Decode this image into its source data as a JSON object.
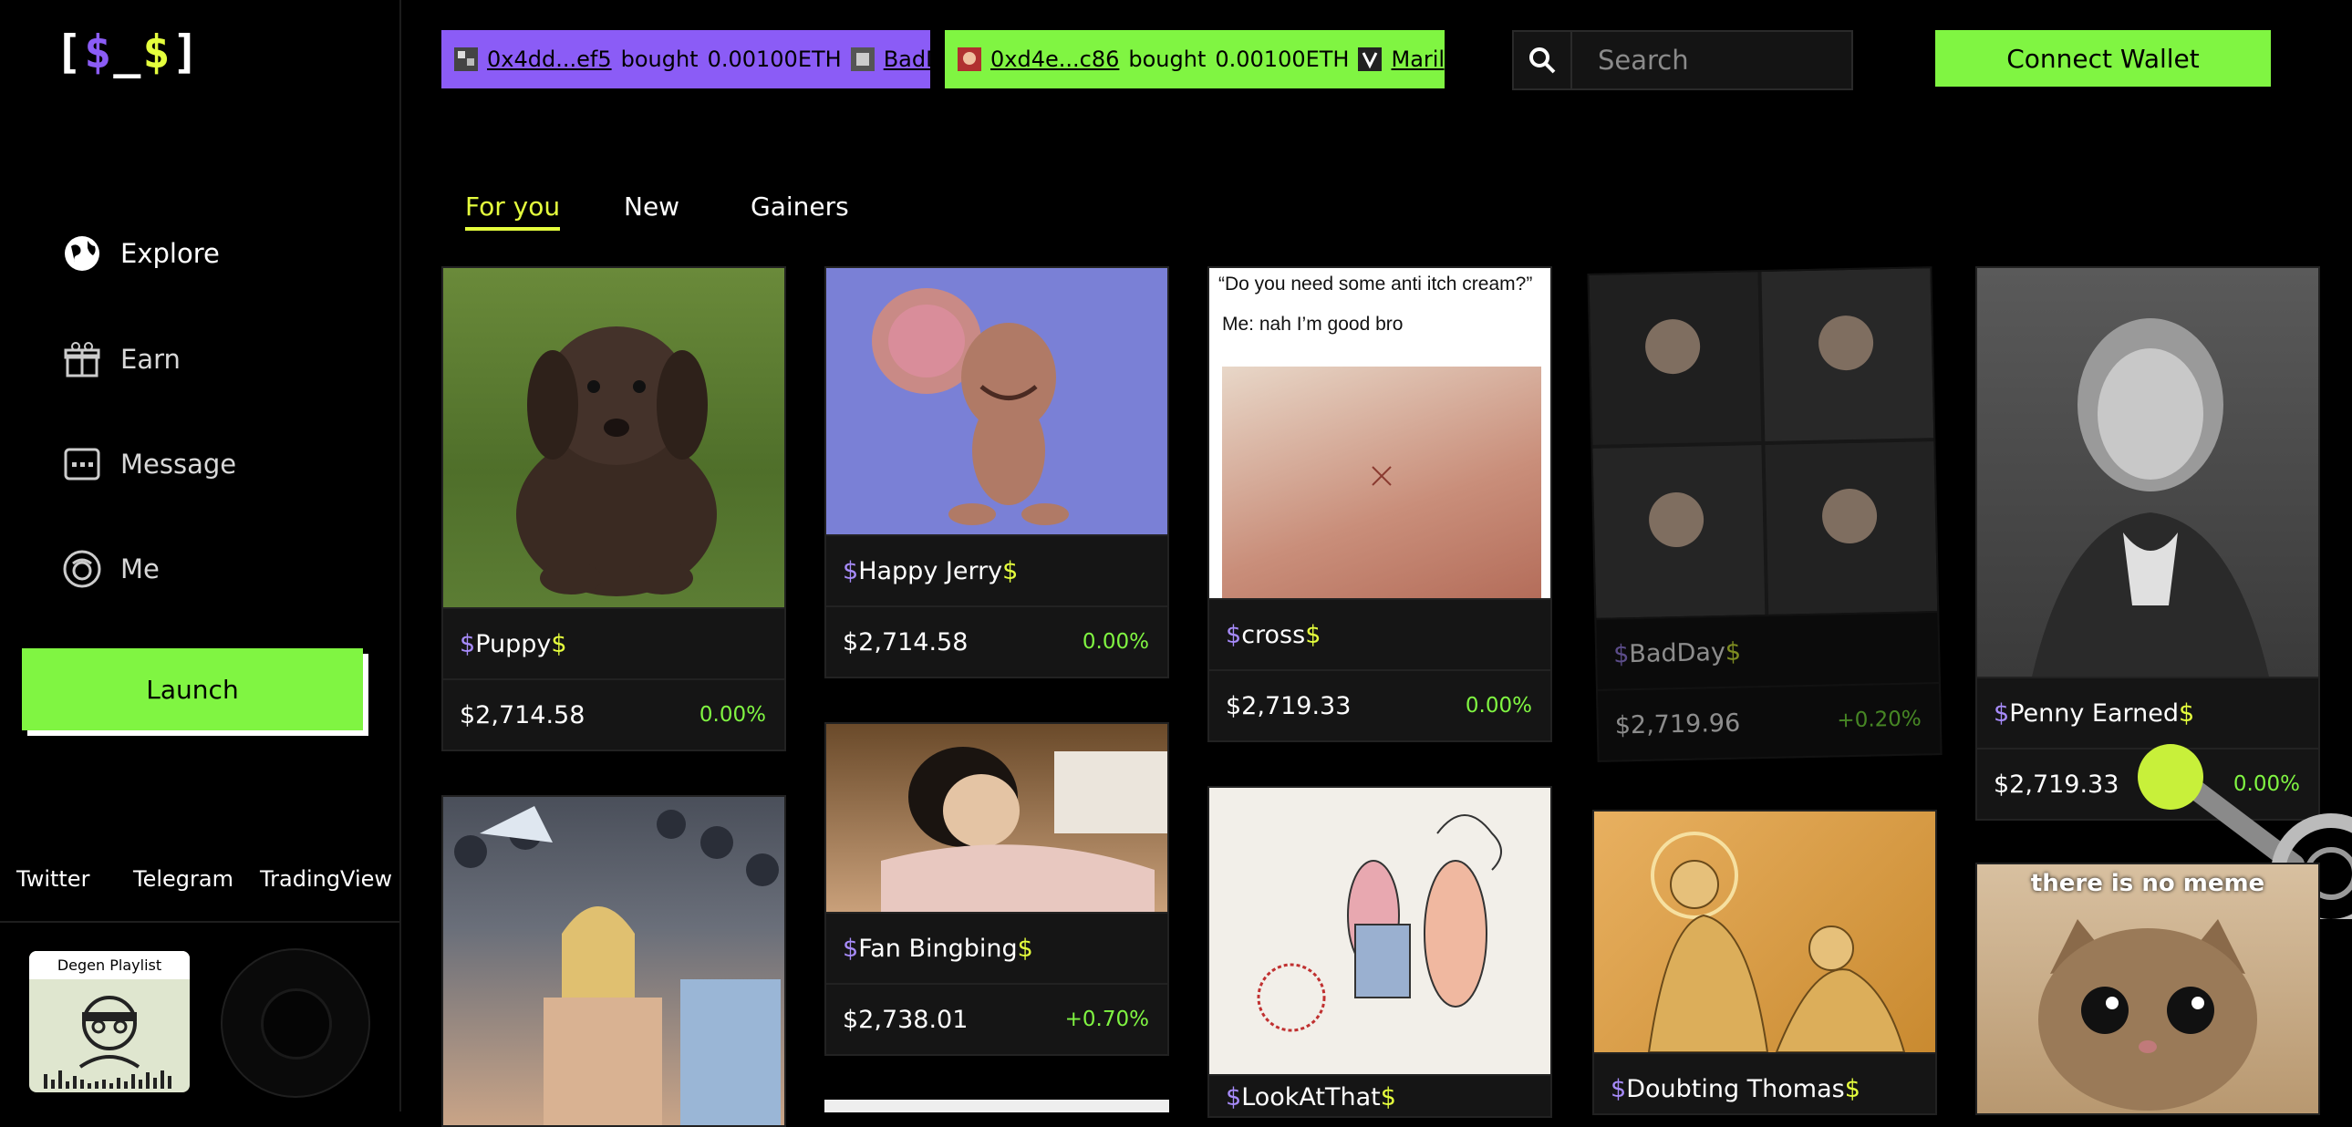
{
  "app": {
    "logo": {
      "left": "[",
      "first": "$",
      "mid": "_",
      "second": "$",
      "right": "]"
    }
  },
  "sidebar": {
    "nav": [
      {
        "label": "Explore",
        "icon": "globe-icon"
      },
      {
        "label": "Earn",
        "icon": "gift-icon"
      },
      {
        "label": "Message",
        "icon": "chat-icon"
      },
      {
        "label": "Me",
        "icon": "user-icon"
      }
    ],
    "launch_label": "Launch",
    "socials": [
      "Twitter",
      "Telegram",
      "TradingView"
    ],
    "playlist_title": "Degen Playlist"
  },
  "ticker": [
    {
      "addr": "0x4dd...ef5",
      "verb": "bought",
      "amount": "0.00100ETH",
      "token": "BadDay",
      "color": "#8b5cf6"
    },
    {
      "addr": "0xd4e...c86",
      "verb": "bought",
      "amount": "0.00100ETH",
      "token": "Marilyn M",
      "color": "#80f542"
    }
  ],
  "search": {
    "placeholder": "Search"
  },
  "connect_label": "Connect Wallet",
  "tabs": [
    {
      "label": "For you",
      "active": true
    },
    {
      "label": "New",
      "active": false
    },
    {
      "label": "Gainers",
      "active": false
    }
  ],
  "cards": {
    "puppy": {
      "name": "Puppy",
      "price": "$2,714.58",
      "change": "0.00%"
    },
    "jerry": {
      "name": "Happy Jerry",
      "price": "$2,714.58",
      "change": "0.00%"
    },
    "cross": {
      "name": "cross",
      "price": "$2,719.33",
      "change": "0.00%",
      "caption1": "“Do you need some anti itch cream?”",
      "caption2": "Me: nah I’m good bro"
    },
    "badday": {
      "name": "BadDay",
      "price": "$2,719.96",
      "change": "+0.20%"
    },
    "penny": {
      "name": "Penny Earned",
      "price": "$2,719.33",
      "change": "0.00%"
    },
    "crowd": {},
    "bingbing": {
      "name": "Fan Bingbing",
      "price": "$2,738.01",
      "change": "+0.70%"
    },
    "lookat": {
      "name": "LookAtThat"
    },
    "thomas": {
      "name": "Doubting Thomas"
    },
    "kitten": {
      "caption": "there is no meme"
    }
  },
  "colors": {
    "accent_green": "#80f542",
    "accent_yellow": "#e5ff3d",
    "accent_purple": "#8b5cf6"
  }
}
